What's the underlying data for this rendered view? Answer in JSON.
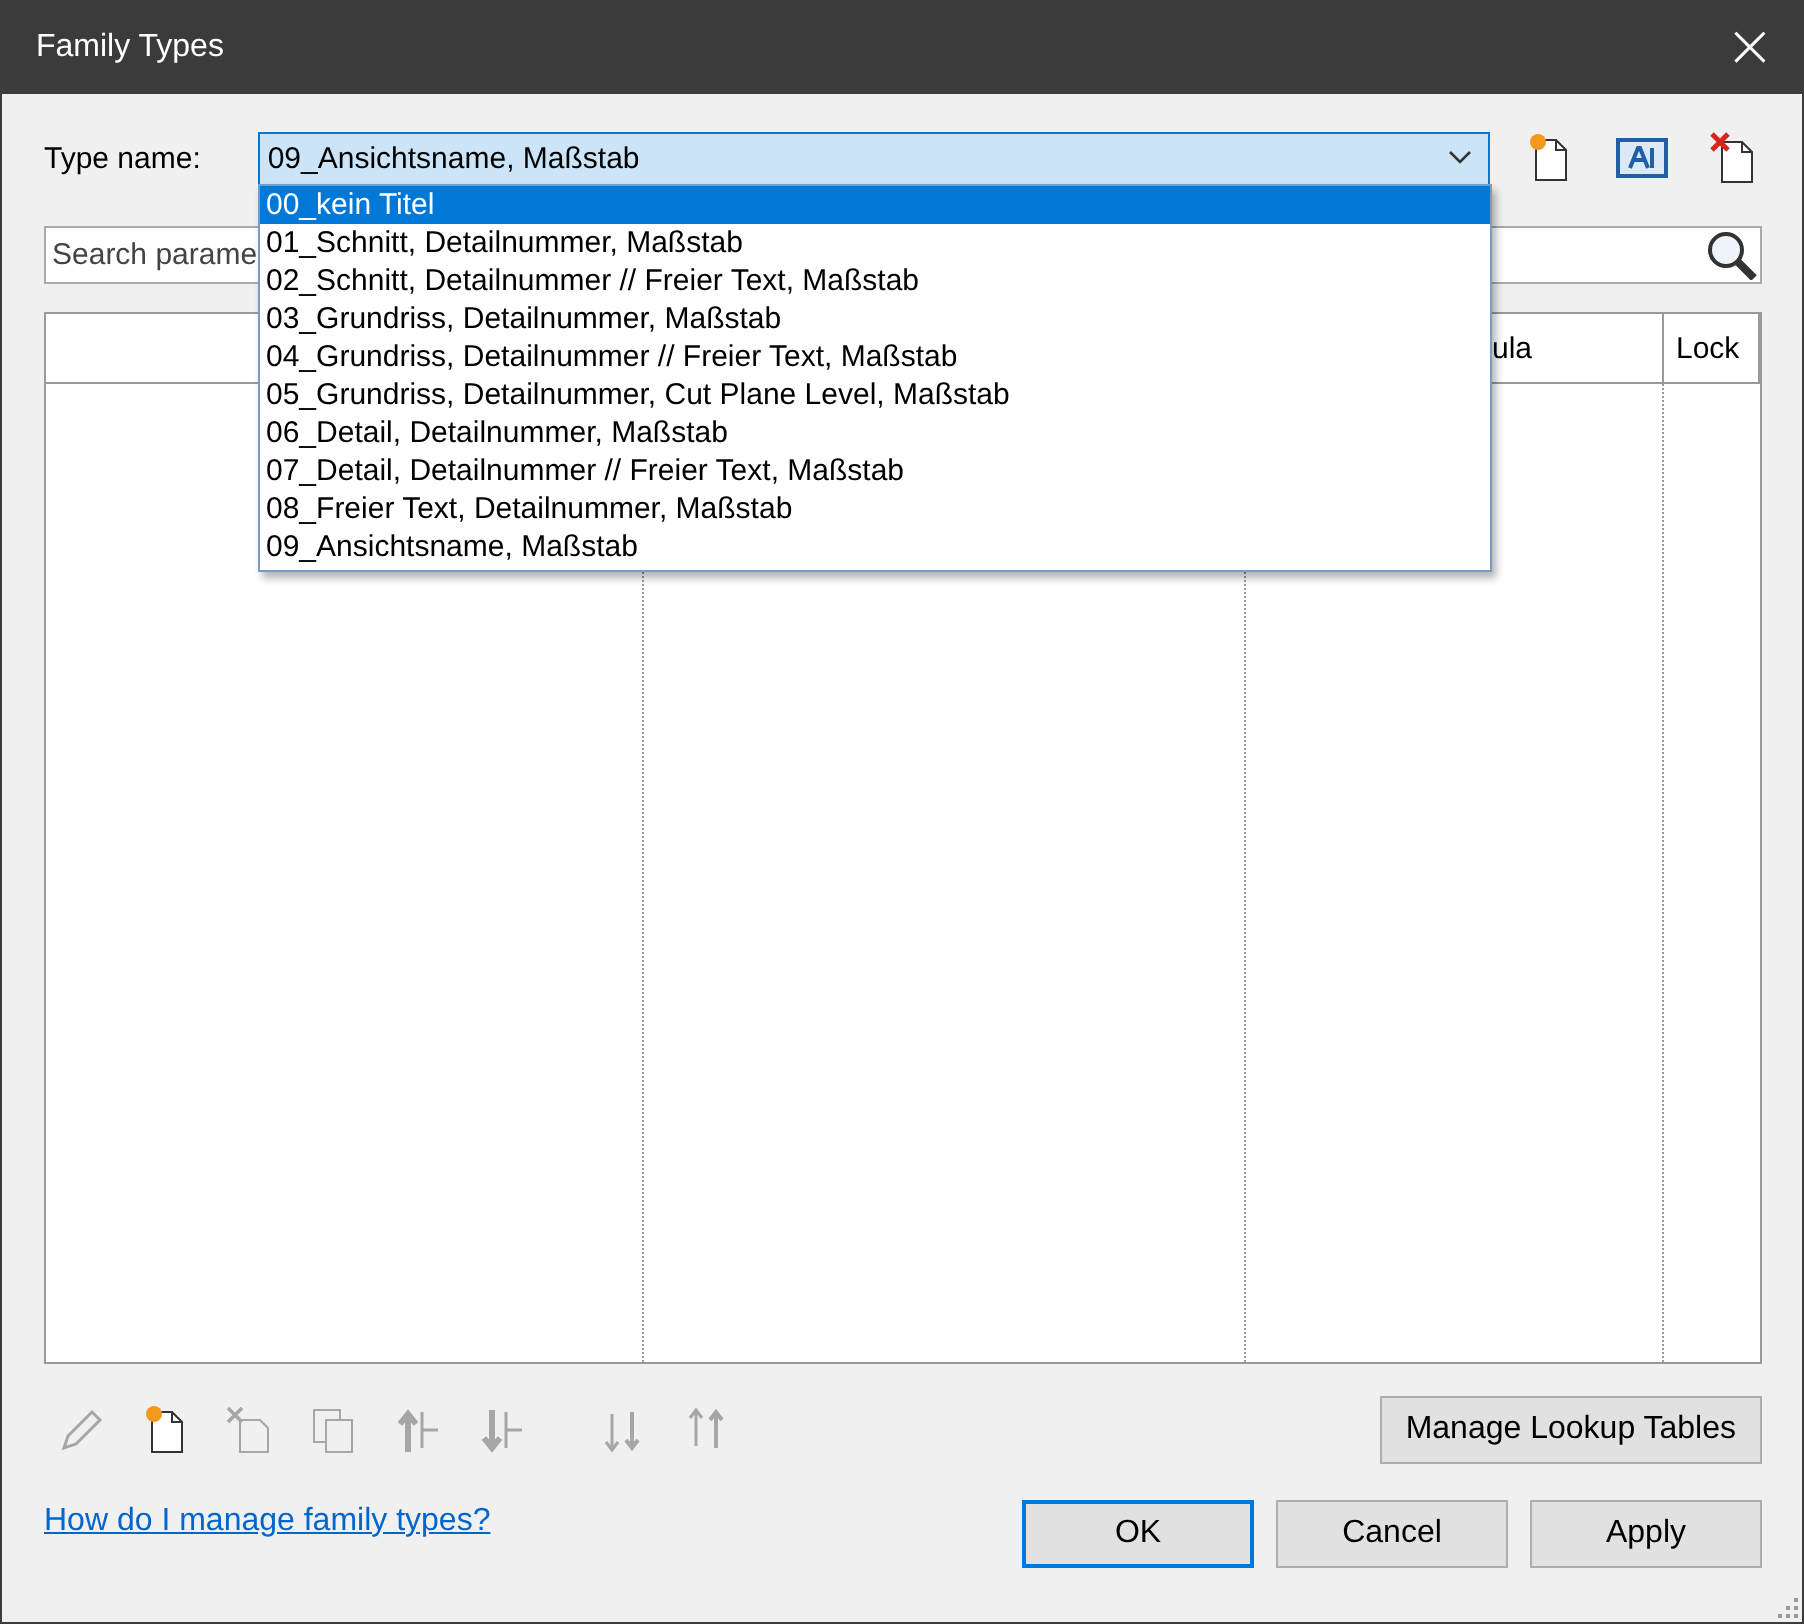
{
  "window": {
    "title": "Family Types",
    "close": "×"
  },
  "type_name": {
    "label": "Type name:",
    "value": "09_Ansichtsname, Maßstab",
    "expanded": true
  },
  "type_tools": [
    {
      "kind": "new"
    },
    {
      "kind": "rename"
    },
    {
      "kind": "delete"
    }
  ],
  "dropdown": [
    {
      "label": "00_kein Titel",
      "selected": true
    },
    {
      "label": "01_Schnitt, Detailnummer, Maßstab",
      "selected": false
    },
    {
      "label": "02_Schnitt, Detailnummer // Freier Text, Maßstab",
      "selected": false
    },
    {
      "label": "03_Grundriss, Detailnummer, Maßstab",
      "selected": false
    },
    {
      "label": "04_Grundriss, Detailnummer // Freier Text, Maßstab",
      "selected": false
    },
    {
      "label": "05_Grundriss, Detailnummer, Cut Plane Level, Maßstab",
      "selected": false
    },
    {
      "label": "06_Detail, Detailnummer, Maßstab",
      "selected": false
    },
    {
      "label": "07_Detail, Detailnummer // Freier Text, Maßstab",
      "selected": false
    },
    {
      "label": "08_Freier Text, Detailnummer, Maßstab",
      "selected": false
    },
    {
      "label": "09_Ansichtsname, Maßstab",
      "selected": false
    }
  ],
  "search": {
    "placeholder": "Search parame"
  },
  "table": {
    "columns": [
      {},
      {},
      {
        "label": "ula"
      },
      {
        "label": "Lock"
      }
    ]
  },
  "parameter_tools": [
    {
      "kind": "edit",
      "disabled": true
    },
    {
      "kind": "new",
      "disabled": false
    },
    {
      "kind": "delete",
      "disabled": true
    },
    {
      "kind": "copy",
      "disabled": true
    },
    {
      "kind": "up",
      "disabled": true
    },
    {
      "kind": "down",
      "disabled": true
    },
    {
      "kind": "sort_asc",
      "disabled": true
    },
    {
      "kind": "sort_desc",
      "disabled": true
    }
  ],
  "lookup_button": "Manage Lookup Tables",
  "help_link": "How do I manage family types?",
  "buttons": [
    {
      "label": "OK",
      "default": true
    },
    {
      "label": "Cancel",
      "default": false
    },
    {
      "label": "Apply",
      "default": false
    }
  ]
}
